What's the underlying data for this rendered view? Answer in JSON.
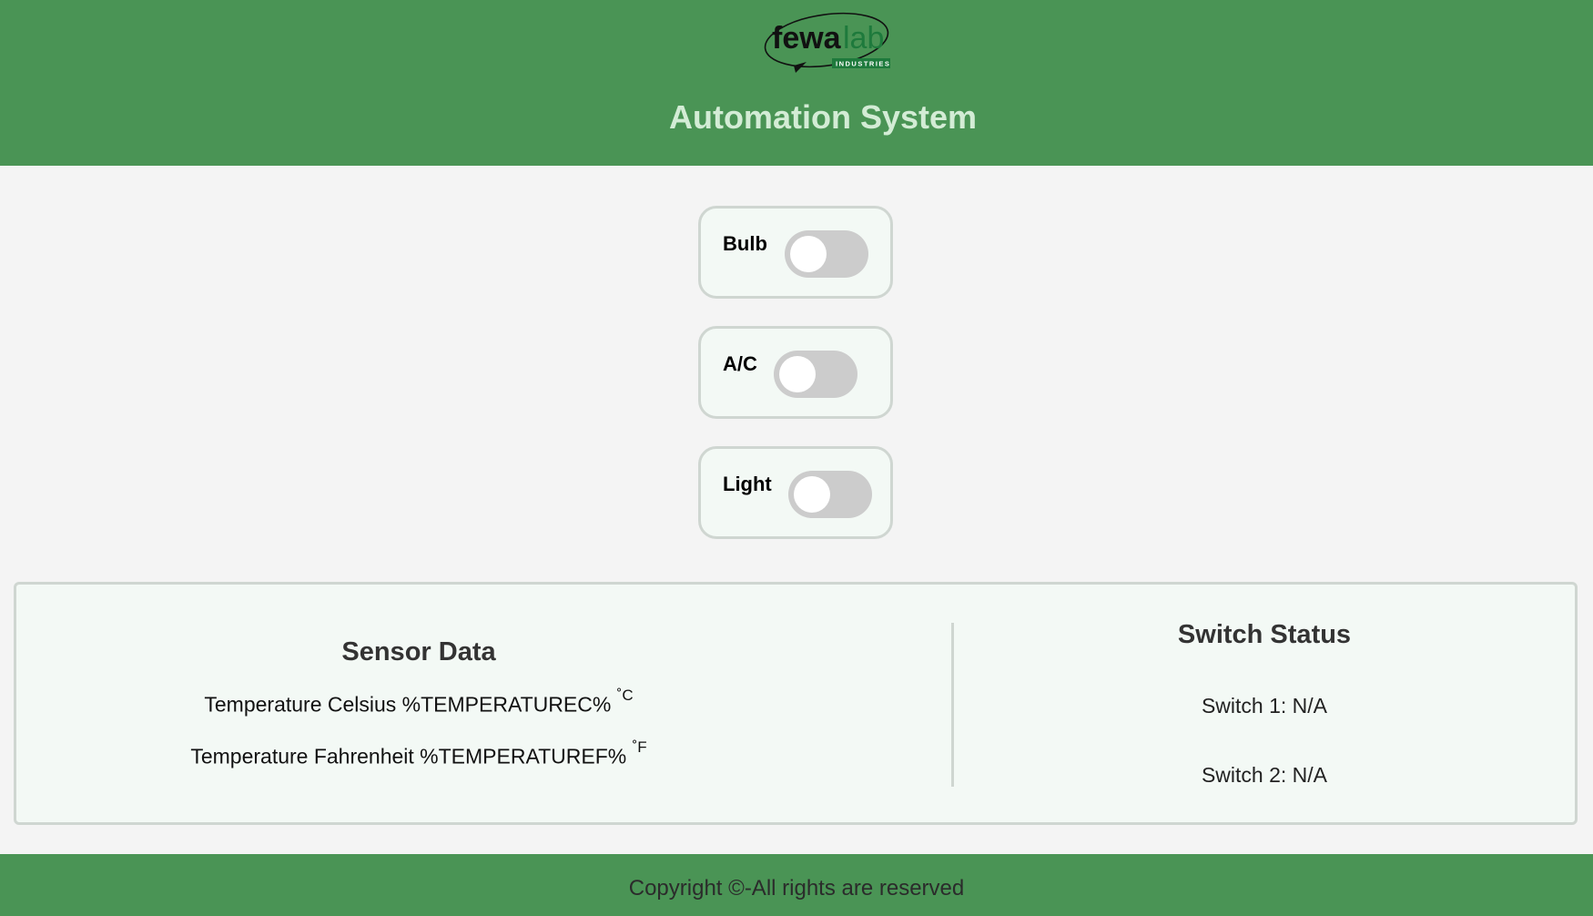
{
  "header": {
    "logo_text": "fewalab",
    "logo_subtext": "INDUSTRIES",
    "title": "Automation System"
  },
  "switches": [
    {
      "label": "Bulb",
      "on": false
    },
    {
      "label": "A/C",
      "on": false
    },
    {
      "label": "Light",
      "on": false
    }
  ],
  "sensor": {
    "title": "Sensor Data",
    "celsius_label": "Temperature Celsius %TEMPERATUREC%",
    "celsius_unit": "˚C",
    "fahrenheit_label": "Temperature Fahrenheit %TEMPERATUREF%",
    "fahrenheit_unit": "˚F"
  },
  "status": {
    "title": "Switch Status",
    "switch1": "Switch 1: N/A",
    "switch2": "Switch 2: N/A"
  },
  "footer": {
    "copyright": "Copyright ©-All rights are reserved"
  },
  "colors": {
    "header_bg": "#4a9455",
    "title": "#d3ecd5",
    "toggle_off": "#cccccc",
    "card_bg": "#f3f9f5"
  }
}
